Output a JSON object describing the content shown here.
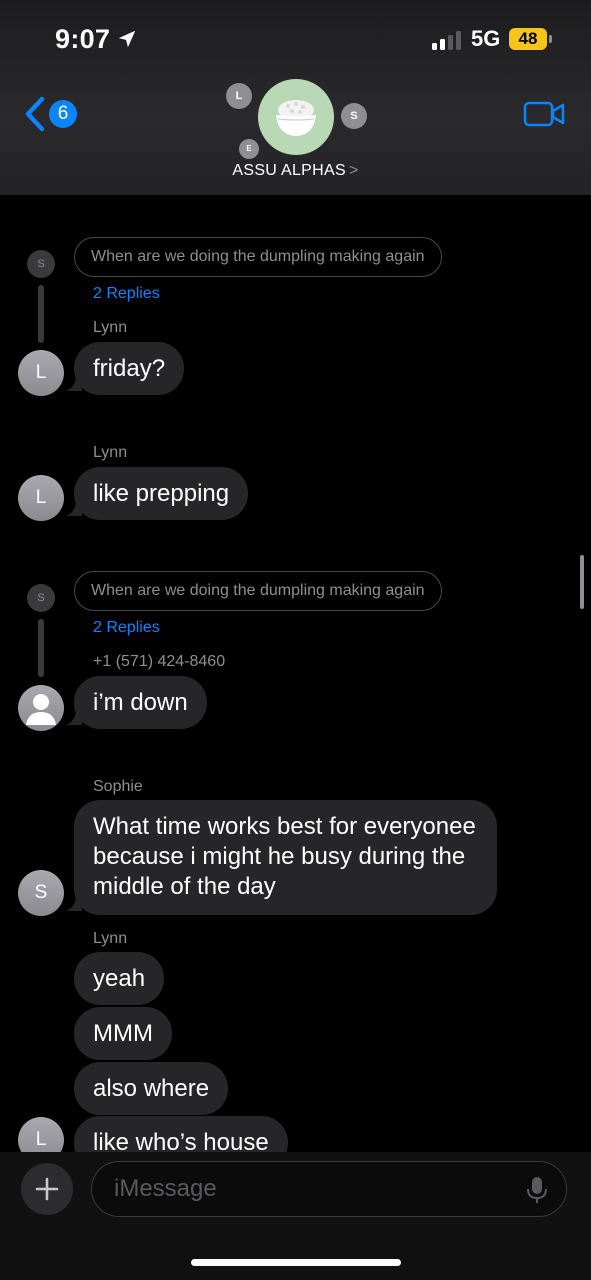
{
  "status_bar": {
    "time": "9:07",
    "network": "5G",
    "battery": "48"
  },
  "header": {
    "back_count": "6",
    "group_name": "ASSU ALPHAS",
    "name_chevron": ">",
    "member_initials": [
      "L",
      "S",
      "E"
    ]
  },
  "messages": [
    {
      "type": "thread",
      "avatar": "S",
      "quote": "When are we doing the dumpling making again",
      "replies": "2 Replies"
    },
    {
      "type": "msg",
      "sender": "Lynn",
      "avatar": "L",
      "text": "friday?"
    },
    {
      "type": "msg",
      "sender": "Lynn",
      "avatar": "L",
      "text": "like prepping"
    },
    {
      "type": "thread",
      "avatar": "S",
      "quote": "When are we doing the dumpling making again",
      "replies": "2 Replies"
    },
    {
      "type": "msg",
      "sender": "+1 (571) 424-8460",
      "avatar": "person-icon",
      "text": "i’m down"
    },
    {
      "type": "msg",
      "sender": "Sophie",
      "avatar": "S",
      "text": "What time works best for everyonee because i might he busy during the middle of the day"
    },
    {
      "type": "group",
      "sender": "Lynn",
      "avatar": "L",
      "texts": [
        "yeah",
        "MMM",
        "also where",
        "like who’s house"
      ]
    }
  ],
  "input": {
    "placeholder": "iMessage",
    "plus_label": "+"
  }
}
